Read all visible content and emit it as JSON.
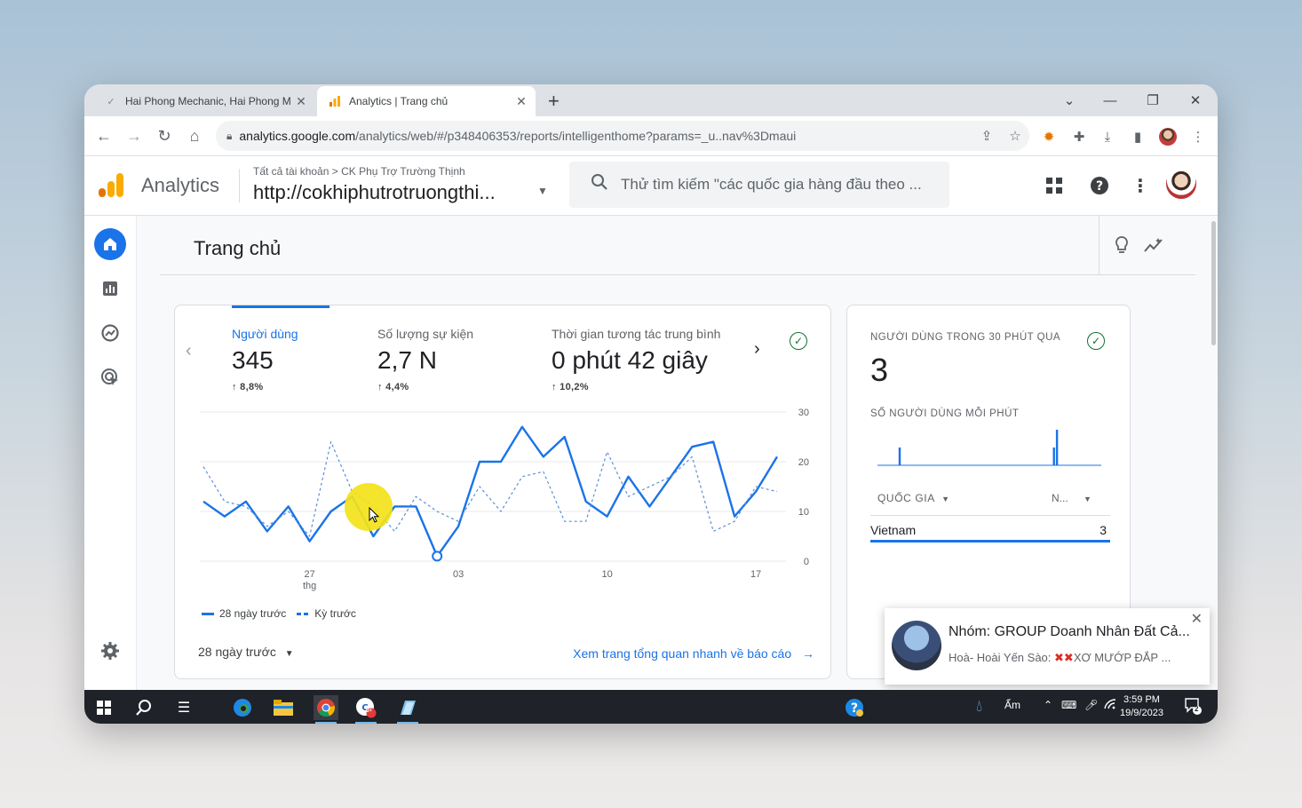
{
  "browser": {
    "tabs": [
      {
        "title": "Hai Phong Mechanic, Hai Phong M",
        "active": false
      },
      {
        "title": "Analytics | Trang chủ",
        "active": true
      }
    ],
    "new_tab": "+",
    "url_host": "analytics.google.com",
    "url_path": "/analytics/web/#/p348406353/reports/intelligenthome?params=_u..nav%3Dmaui"
  },
  "ga": {
    "brand": "Analytics",
    "breadcrumb_account": "Tất cả tài khoản",
    "breadcrumb_sep": ">",
    "breadcrumb_property": "CK Phụ Trợ Trường Thịnh",
    "property_name": "http://cokhiphutrotruongthi...",
    "search_placeholder": "Thử tìm kiếm \"các quốc gia hàng đầu theo ..."
  },
  "page": {
    "title": "Trang chủ"
  },
  "metrics": [
    {
      "label": "Người dùng",
      "value": "345",
      "delta": "8,8%"
    },
    {
      "label": "Số lượng sự kiện",
      "value": "2,7 N",
      "delta": "4,4%"
    },
    {
      "label": "Thời gian tương tác trung bình",
      "value": "0 phút 42 giây",
      "delta": "10,2%"
    }
  ],
  "chart_data": {
    "type": "line",
    "y_ticks": [
      "30",
      "20",
      "10",
      "0"
    ],
    "ylim": [
      0,
      30
    ],
    "x_ticks": [
      {
        "label": "27",
        "sub": "thg",
        "index": 5
      },
      {
        "label": "03",
        "sub": "",
        "index": 12
      },
      {
        "label": "10",
        "sub": "",
        "index": 19
      },
      {
        "label": "17",
        "sub": "",
        "index": 26
      }
    ],
    "series": [
      {
        "name": "28 ngày trước",
        "style": "solid",
        "values": [
          12,
          9,
          12,
          6,
          11,
          4,
          10,
          13,
          5,
          11,
          11,
          1,
          7,
          20,
          20,
          27,
          21,
          25,
          12,
          9,
          17,
          11,
          17,
          23,
          24,
          9,
          14,
          21
        ]
      },
      {
        "name": "Kỳ trước",
        "style": "dashed",
        "values": [
          19,
          12,
          11,
          7,
          10,
          5,
          24,
          14,
          11,
          6,
          13,
          10,
          8,
          15,
          10,
          17,
          18,
          8,
          8,
          22,
          13,
          15,
          17,
          21,
          6,
          8,
          15,
          14
        ]
      }
    ]
  },
  "legend": {
    "current": "28 ngày trước",
    "previous": "Kỳ trước"
  },
  "range_selector": "28 ngày trước",
  "view_report_link": "Xem trang tổng quan nhanh về báo cáo",
  "realtime": {
    "title": "NGƯỜI DÙNG TRONG 30 PHÚT QUA",
    "value": "3",
    "per_minute_label": "SỐ NGƯỜI DÙNG MỖI PHÚT",
    "per_minute": [
      0,
      0,
      0,
      0,
      0,
      0,
      0,
      1,
      0,
      0,
      0,
      0,
      0,
      0,
      0,
      0,
      0,
      0,
      0,
      0,
      0,
      0,
      0,
      0,
      0,
      0,
      0,
      0,
      0,
      0,
      0,
      0,
      0,
      0,
      0,
      0,
      0,
      0,
      0,
      0,
      0,
      0,
      0,
      0,
      0,
      0,
      0,
      0,
      0,
      0,
      0,
      0,
      0,
      0,
      0,
      0,
      0,
      0,
      1,
      2,
      0,
      0,
      0,
      0,
      0,
      0,
      0,
      0,
      0,
      0,
      0,
      0,
      0,
      0
    ],
    "col_country": "QUỐC GIA",
    "col_metric": "N...",
    "rows": [
      {
        "country": "Vietnam",
        "count": "3"
      }
    ]
  },
  "notification": {
    "title": "Nhóm: GROUP Doanh Nhân Đất Cả...",
    "message_prefix": "Hoà- Hoài Yến Sào:",
    "message_rest": "XƠ MƯỚP ĐẮP ..."
  },
  "taskbar": {
    "weather": "Ẩm",
    "time": "3:59 PM",
    "date": "19/9/2023",
    "notif_count": "2",
    "chat_badge": "5+"
  },
  "colors": {
    "accent": "#1a73e8",
    "ok": "#137333",
    "orange": "#f9ab00"
  }
}
